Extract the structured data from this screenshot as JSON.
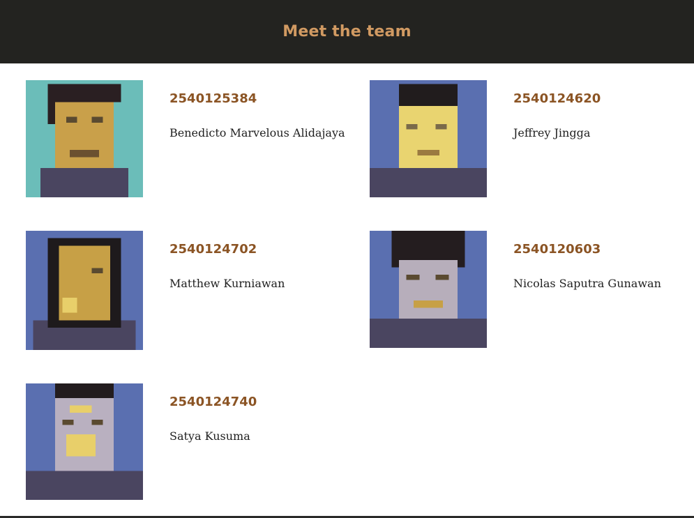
{
  "header": {
    "title": "Meet the team"
  },
  "team": [
    {
      "id": "2540125384",
      "name": "Benedicto Marvelous Alidajaya",
      "bg": "#6bbdb9",
      "skin": "#c9a04a",
      "hair": "#2a1f22"
    },
    {
      "id": "2540124620",
      "name": "Jeffrey Jingga",
      "bg": "#5a6fb0",
      "skin": "#e9d470",
      "hair": "#211c1d"
    },
    {
      "id": "2540124702",
      "name": "Matthew Kurniawan",
      "bg": "#5a6fb0",
      "skin": "#c7a046",
      "hair": "#1e1a1c"
    },
    {
      "id": "2540120603",
      "name": "Nicolas Saputra Gunawan",
      "bg": "#5a6fb0",
      "skin": "#b7aebb",
      "hair": "#241d1f"
    },
    {
      "id": "2540124740",
      "name": "Satya Kusuma",
      "bg": "#5a6fb0",
      "skin": "#b9b0c0",
      "hair": "#231c1e"
    }
  ]
}
